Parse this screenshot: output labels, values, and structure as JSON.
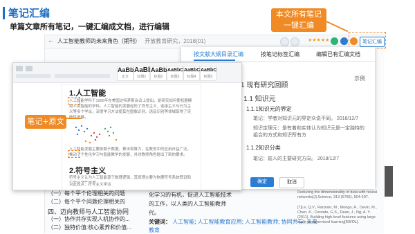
{
  "slide": {
    "title": "笔记汇编",
    "subtitle": "单篇文章所有笔记，一键汇编成文档，进行编辑"
  },
  "callouts": {
    "top_line1": "本文所有笔记",
    "top_line2": "一键汇编",
    "left": "笔记+原文"
  },
  "topbar": {
    "back_arrow": "←",
    "doc_title": "人工智能教师的未来角色（期刊）",
    "doc_meta": "开放教育研究，2018(01)",
    "stars": "★★★★★",
    "summary_button": "笔记汇编"
  },
  "panel": {
    "tabs": [
      "按文献大纲目录汇编",
      "按笔记标签汇编",
      "编辑已有汇编文档"
    ],
    "sample_label": "示例",
    "outline": {
      "h1": "1 现有研究回顾",
      "h2": "1.1 知识元",
      "h3a": "1.1.1知识元的界定",
      "note1": "笔记：学者对知识元的界定众说不同。 2018/12/7",
      "note2_line1": "知识定理元：是有着和实体认为知识元是一定独特的",
      "note2_line2": "组合的方式和知识所有方",
      "h3b": "1.1.2知识分类",
      "note3": "笔记：前人的主要研究方向。 2018/12/7"
    },
    "ok_button": "确定",
    "cancel_button": "取消"
  },
  "editor": {
    "styles": [
      {
        "big": "AaBb",
        "small": "正文"
      },
      {
        "big": "AaBb",
        "small": "标题1"
      },
      {
        "big": "AaBb",
        "small": "标题2"
      },
      {
        "big": "AaBbC",
        "small": "标题3"
      },
      {
        "big": "AaBbC",
        "small": "标题4"
      },
      {
        "big": "AaBbC",
        "small": "标题5"
      }
    ],
    "heading1": "1.人工智能",
    "para1": "人工智能学科于1956年在美国达特茅斯会议上提出，是研究如何使机器模拟人类智能的学科。人工智能的发展经历了符号主义、连接主义与行为主义等多个学派，深度学习方法使其在图像识别、语音识别等领域取得了突破性进展。",
    "para2": "人工智能发展主要依赖于数据、算法和算力，在教育中的应用日益广泛，推动了个性化学习与智能教学的发展，并对教师角色提出了新的要求。",
    "heading2": "2.符号主义",
    "para3": "符号主义认为人工智能源于数理逻辑，其原理主要为物理符号系统假设和有限合理性原理。",
    "para4": "对此观点：符号主义学派"
  },
  "background": {
    "item1": "（一）每个平个伦理相关的问题",
    "item2": "（二）每个平个问题伦理相关的",
    "item3": "四、迈向教师与人工智能协同",
    "item4": "（一）协作共存实现人机协作的...",
    "item5": "（二）独特价值:核心素养和价值...",
    "mid_line1": "化学习的有机，促进人工智能技术",
    "mid_line2": "的工作，以人类的人工智能教师",
    "mid_line3": "代。",
    "kw_label": "关键词：",
    "kw1": "人工智能",
    "kw2": "人工智能教育应用",
    "kw3": "人工智能教师",
    "kw4": "协同共存",
    "kw5": "未来",
    "kw6": "教育",
    "ref1": "Reducing the dimensionality of data with neural networks[J].Science, 313 (5786), 504-507.",
    "ref2": "[7]Le, Q.V., Ranzato, M., Monga, R., Devin, M., Chen, K., Corrado, G.S., Dean, J., Ng, A. Y. (2011). Building high-level features using large scale unsupervised learning[EB/OL]."
  }
}
